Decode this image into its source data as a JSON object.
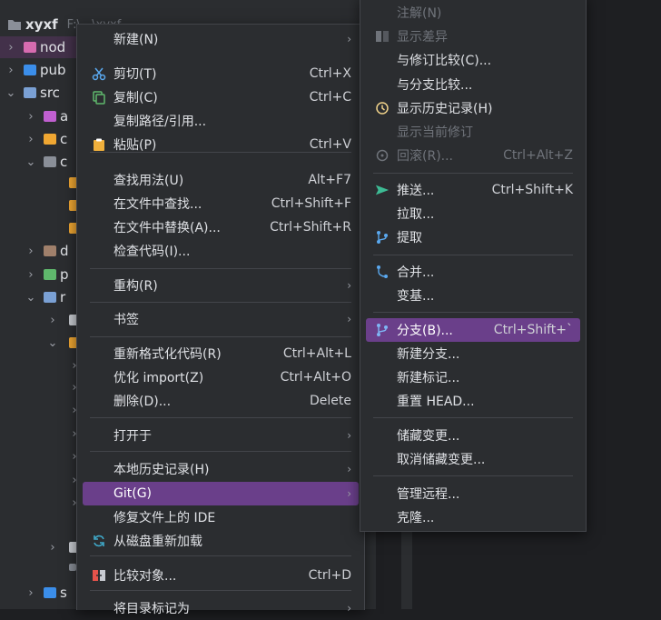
{
  "tree": {
    "root_name": "xyxf",
    "root_path": "F:\\...\\xyxf",
    "items": [
      {
        "label": "nod",
        "color": "#d76bb0"
      },
      {
        "label": "pub",
        "color": "#3b8eea"
      },
      {
        "label": "src",
        "color": "#7aa0d4"
      },
      {
        "label": "a",
        "color": "#c05fd0"
      },
      {
        "label": "c",
        "color": "#f0a732"
      },
      {
        "label": "c",
        "color": "#8a8f98"
      },
      {
        "label": "d",
        "color": "#a0806b"
      },
      {
        "label": "p",
        "color": "#5fb86c"
      },
      {
        "label": "r",
        "color": "#7aa0d4"
      },
      {
        "label": "s",
        "color": "#3b8eea"
      }
    ]
  },
  "menu_main": {
    "items": [
      {
        "label": "新建(N)",
        "shortcut": "",
        "submenu": true
      },
      {
        "label": "剪切(T)",
        "shortcut": "Ctrl+X",
        "icon": "scissors-icon"
      },
      {
        "label": "复制(C)",
        "shortcut": "Ctrl+C",
        "icon": "copy-icon"
      },
      {
        "label": "复制路径/引用...",
        "shortcut": ""
      },
      {
        "label": "粘贴(P)",
        "shortcut": "Ctrl+V",
        "icon": "clipboard-icon"
      },
      {
        "label": "查找用法(U)",
        "shortcut": "Alt+F7"
      },
      {
        "label": "在文件中查找...",
        "shortcut": "Ctrl+Shift+F"
      },
      {
        "label": "在文件中替换(A)...",
        "shortcut": "Ctrl+Shift+R"
      },
      {
        "label": "检查代码(I)...",
        "shortcut": ""
      },
      {
        "label": "重构(R)",
        "shortcut": "",
        "submenu": true
      },
      {
        "label": "书签",
        "shortcut": "",
        "submenu": true
      },
      {
        "label": "重新格式化代码(R)",
        "shortcut": "Ctrl+Alt+L"
      },
      {
        "label": "优化 import(Z)",
        "shortcut": "Ctrl+Alt+O"
      },
      {
        "label": "删除(D)...",
        "shortcut": "Delete"
      },
      {
        "label": "打开于",
        "shortcut": "",
        "submenu": true
      },
      {
        "label": "本地历史记录(H)",
        "shortcut": "",
        "submenu": true
      },
      {
        "label": "Git(G)",
        "shortcut": "",
        "submenu": true
      },
      {
        "label": "修复文件上的 IDE",
        "shortcut": ""
      },
      {
        "label": "从磁盘重新加载",
        "shortcut": "",
        "icon": "reload-icon"
      },
      {
        "label": "比较对象...",
        "shortcut": "Ctrl+D",
        "icon": "compare-icon"
      },
      {
        "label": "将目录标记为",
        "shortcut": "",
        "submenu": true
      }
    ]
  },
  "menu_git": {
    "items": [
      {
        "label": "注解(N)",
        "shortcut": ""
      },
      {
        "label": "显示差异",
        "shortcut": "",
        "icon": "diff-icon"
      },
      {
        "label": "与修订比较(C)...",
        "shortcut": ""
      },
      {
        "label": "与分支比较...",
        "shortcut": ""
      },
      {
        "label": "显示历史记录(H)",
        "shortcut": "",
        "icon": "history-icon"
      },
      {
        "label": "显示当前修订",
        "shortcut": ""
      },
      {
        "label": "回滚(R)...",
        "shortcut": "Ctrl+Alt+Z",
        "icon": "rollback-icon"
      },
      {
        "label": "推送...",
        "shortcut": "Ctrl+Shift+K",
        "icon": "push-icon"
      },
      {
        "label": "拉取...",
        "shortcut": ""
      },
      {
        "label": "提取",
        "shortcut": "",
        "icon": "fetch-icon"
      },
      {
        "label": "合并...",
        "shortcut": "",
        "icon": "merge-icon"
      },
      {
        "label": "变基...",
        "shortcut": ""
      },
      {
        "label": "分支(B)...",
        "shortcut": "Ctrl+Shift+`",
        "icon": "branch-icon"
      },
      {
        "label": "新建分支...",
        "shortcut": ""
      },
      {
        "label": "新建标记...",
        "shortcut": ""
      },
      {
        "label": "重置 HEAD...",
        "shortcut": ""
      },
      {
        "label": "储藏变更...",
        "shortcut": ""
      },
      {
        "label": "取消储藏变更...",
        "shortcut": ""
      },
      {
        "label": "管理远程...",
        "shortcut": ""
      },
      {
        "label": "克隆...",
        "shortcut": ""
      }
    ]
  },
  "colors": {
    "selection": "#6a3f8a",
    "menu_bg": "#2b2d30",
    "tree_selection": "#43314a"
  }
}
